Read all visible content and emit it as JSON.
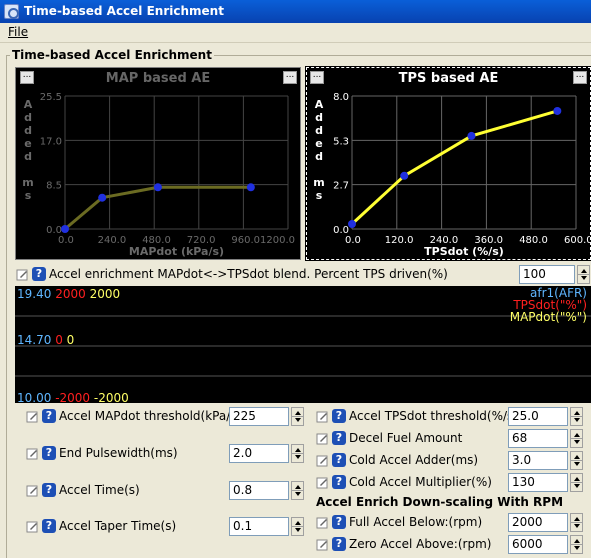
{
  "window": {
    "title": "Time-based Accel Enrichment"
  },
  "menu": {
    "file": "File"
  },
  "frame_title": "Time-based Accel Enrichment",
  "map_chart": {
    "title": "MAP based AE",
    "ylabel": "Added ms",
    "xlabel": "MAPdot (kPa/s)",
    "yticks": [
      "25.5",
      "17.0",
      "8.5",
      "0.0"
    ],
    "xticks": [
      "0.0",
      "240.0",
      "480.0",
      "720.0",
      "960.01200.0"
    ],
    "line_color": "#6b6b22"
  },
  "tps_chart": {
    "title": "TPS based AE",
    "ylabel": "Added ms",
    "xlabel": "TPSdot (%/s)",
    "yticks": [
      "8.0",
      "5.3",
      "2.7",
      "0.0"
    ],
    "xticks": [
      "0.0",
      "120.0",
      "240.0",
      "360.0",
      "480.0",
      "600.0"
    ],
    "line_color": "#ffff33"
  },
  "chart_data": [
    {
      "type": "line",
      "title": "MAP based AE",
      "xlabel": "MAPdot (kPa/s)",
      "ylabel": "Added ms",
      "xlim": [
        0,
        1200
      ],
      "ylim": [
        0,
        25.5
      ],
      "x": [
        0,
        200,
        500,
        1000
      ],
      "y": [
        0,
        6,
        8,
        8
      ],
      "grid": true
    },
    {
      "type": "line",
      "title": "TPS based AE",
      "xlabel": "TPSdot (%/s)",
      "ylabel": "Added ms",
      "xlim": [
        0,
        600
      ],
      "ylim": [
        0,
        8
      ],
      "x": [
        0,
        140,
        320,
        550
      ],
      "y": [
        0.3,
        3.2,
        5.6,
        7.1
      ],
      "grid": true
    }
  ],
  "blend": {
    "label": "Accel enrichment MAPdot<->TPSdot blend. Percent TPS driven(%)",
    "value": "100"
  },
  "scope": {
    "top_left": [
      "19.40",
      "2000",
      "2000"
    ],
    "mid_left": [
      "14.70",
      "0",
      "0"
    ],
    "bot_left": [
      "10.00",
      "-2000",
      "-2000"
    ],
    "legend": [
      "afr1(AFR)",
      "TPSdot(\"%\")",
      "MAPdot(\"%\")"
    ],
    "colors": {
      "afr": "#5fb6ff",
      "tps": "#ff2020",
      "map": "#ffff66"
    }
  },
  "left_fields": [
    {
      "label": "Accel MAPdot threshold(kPa/s)",
      "value": "225"
    },
    {
      "label": "End Pulsewidth(ms)",
      "value": "2.0"
    },
    {
      "label": "Accel Time(s)",
      "value": "0.8"
    },
    {
      "label": "Accel Taper Time(s)",
      "value": "0.1"
    }
  ],
  "right_fields": [
    {
      "label": "Accel TPSdot threshold(%/s)",
      "value": "25.0"
    },
    {
      "label": "Decel Fuel Amount",
      "value": "68"
    },
    {
      "label": "Cold Accel Adder(ms)",
      "value": "3.0"
    },
    {
      "label": "Cold Accel Multiplier(%)",
      "value": "130"
    }
  ],
  "rpm_section": {
    "title": "Accel Enrich Down-scaling With RPM",
    "fields": [
      {
        "label": "Full Accel Below:(rpm)",
        "value": "2000"
      },
      {
        "label": "Zero Accel Above:(rpm)",
        "value": "6000"
      }
    ]
  }
}
